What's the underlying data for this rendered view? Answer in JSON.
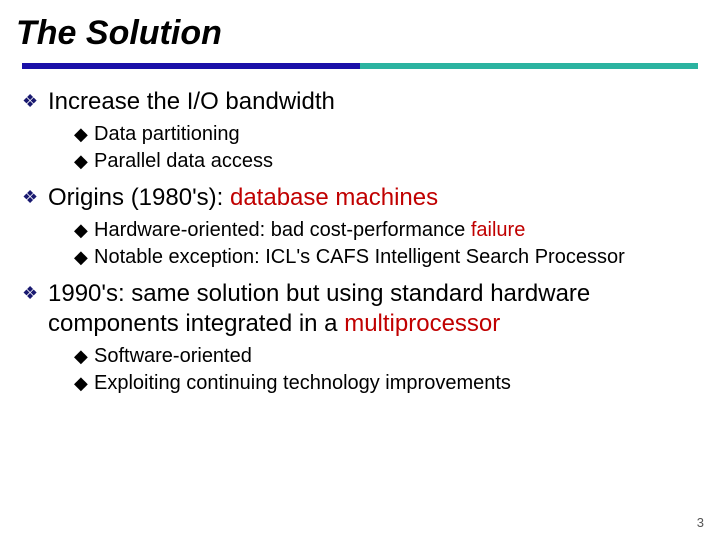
{
  "title": "The Solution",
  "page_number": "3",
  "items": [
    {
      "text": "Increase the I/O bandwidth",
      "sub": [
        {
          "text": "Data partitioning"
        },
        {
          "text": "Parallel data access"
        }
      ]
    },
    {
      "segments": [
        {
          "text": "Origins (1980's): "
        },
        {
          "text": "database machines",
          "accent": true
        }
      ],
      "sub": [
        {
          "segments": [
            {
              "text": "Hardware-oriented:  bad cost-performance  "
            },
            {
              "text": "failure",
              "accent": true
            }
          ]
        },
        {
          "text": "Notable exception: ICL's CAFS Intelligent Search Processor"
        }
      ]
    },
    {
      "segments": [
        {
          "text": "1990's: same solution but using standard hardware components integrated in a "
        },
        {
          "text": "multiprocessor",
          "accent": true
        }
      ],
      "sub": [
        {
          "text": "Software-oriented"
        },
        {
          "text": "Exploiting continuing technology improvements"
        }
      ]
    }
  ]
}
